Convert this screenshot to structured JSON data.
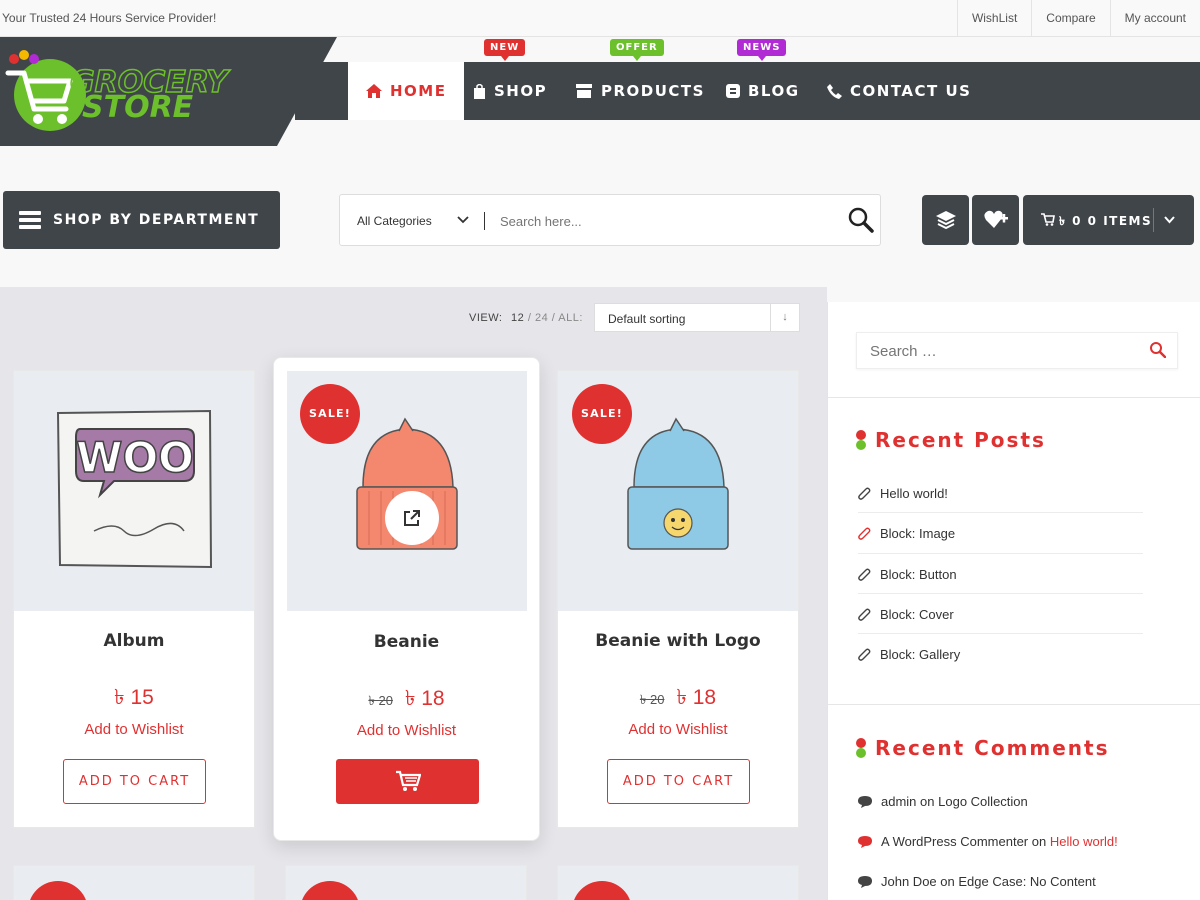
{
  "topbar": {
    "tagline": "Your Trusted 24 Hours Service Provider!",
    "links": [
      "WishList",
      "Compare",
      "My account"
    ]
  },
  "logo": {
    "line1": "GROCERY",
    "line2": "STORE"
  },
  "nav": {
    "home": "HOME",
    "shop": "SHOP",
    "products": "PRODUCTS",
    "blog": "BLOG",
    "contact": "CONTACT US",
    "badges": {
      "new": "NEW",
      "offer": "OFFER",
      "news": "NEWS"
    }
  },
  "department": {
    "label": "SHOP BY DEPARTMENT"
  },
  "search": {
    "category": "All Categories",
    "placeholder": "Search here..."
  },
  "cart": {
    "label": "৳ 0 0 ITEMS"
  },
  "toolbar": {
    "view_label": "VIEW:",
    "view_12": "12",
    "view_rest": "/ 24 / ALL:",
    "sort": "Default sorting"
  },
  "products": [
    {
      "title": "Album",
      "price": "৳ 15",
      "old_price": "",
      "wishlist": "Add to Wishlist",
      "button": "ADD TO CART"
    },
    {
      "title": "Beanie",
      "price": "৳ 18",
      "old_price": "৳ 20",
      "wishlist": "Add to Wishlist",
      "button": "",
      "sale": "SALE!"
    },
    {
      "title": "Beanie with Logo",
      "price": "৳ 18",
      "old_price": "৳ 20",
      "wishlist": "Add to Wishlist",
      "button": "ADD TO CART",
      "sale": "SALE!"
    }
  ],
  "sidebar": {
    "search_placeholder": "Search …",
    "recent_posts_title": "Recent Posts",
    "posts": [
      "Hello world!",
      "Block: Image",
      "Block: Button",
      "Block: Cover",
      "Block: Gallery"
    ],
    "recent_comments_title": "Recent Comments",
    "comments": [
      {
        "author": "admin",
        "on": "on",
        "post": "Logo Collection"
      },
      {
        "author": "A WordPress Commenter",
        "on": "on",
        "post": "Hello world!"
      },
      {
        "author": "John Doe",
        "on": "on",
        "post": "Edge Case: No Content"
      }
    ]
  },
  "colors": {
    "accent": "#e03131",
    "dark": "#40454a",
    "green": "#6cc02b",
    "purple": "#b12bd4"
  }
}
